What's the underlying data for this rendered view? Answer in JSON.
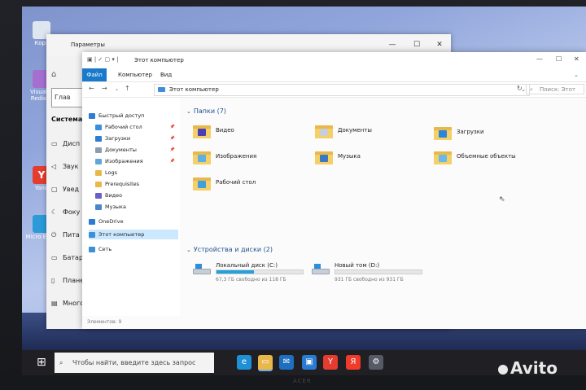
{
  "desktop": {
    "icons": [
      {
        "label": "Корз"
      },
      {
        "label": "Visual C Redistri"
      },
      {
        "label": "Yand"
      },
      {
        "label": "Micro Edge"
      }
    ]
  },
  "settings": {
    "title": "Параметры",
    "search_value": "Глав",
    "section": "Система",
    "items": [
      {
        "label": "Дисп",
        "icon": "monitor-icon"
      },
      {
        "label": "Звук",
        "icon": "speaker-icon"
      },
      {
        "label": "Увед",
        "icon": "notification-icon"
      },
      {
        "label": "Фоку",
        "icon": "moon-icon"
      },
      {
        "label": "Пита",
        "icon": "power-icon"
      },
      {
        "label": "Батар",
        "icon": "battery-icon"
      },
      {
        "label": "Плане",
        "icon": "tablet-icon"
      },
      {
        "label": "Много",
        "icon": "multitask-icon"
      }
    ]
  },
  "explorer": {
    "title": "Этот компьютер",
    "ribbon_tabs": [
      "Файл",
      "Компьютер",
      "Вид"
    ],
    "address": "Этот компьютер",
    "search_placeholder": "Поиск: Этот компьютер",
    "nav": [
      {
        "label": "Быстрый доступ",
        "icon": "star-icon",
        "color": "#2e7dd1",
        "pinned": false,
        "indent": 0
      },
      {
        "label": "Рабочий стол",
        "icon": "desktop-folder-icon",
        "color": "#3b8fd9",
        "pinned": true,
        "indent": 1
      },
      {
        "label": "Загрузки",
        "icon": "download-icon",
        "color": "#2e7dd1",
        "pinned": true,
        "indent": 1
      },
      {
        "label": "Документы",
        "icon": "documents-icon",
        "color": "#8d9bb0",
        "pinned": true,
        "indent": 1
      },
      {
        "label": "Изображения",
        "icon": "pictures-icon",
        "color": "#5ea8d8",
        "pinned": true,
        "indent": 1
      },
      {
        "label": "Logs",
        "icon": "folder-icon",
        "color": "#e8b84a",
        "pinned": false,
        "indent": 1
      },
      {
        "label": "Prerequisites",
        "icon": "folder-icon",
        "color": "#e8b84a",
        "pinned": false,
        "indent": 1
      },
      {
        "label": "Видео",
        "icon": "video-folder-icon",
        "color": "#6a5fc7",
        "pinned": false,
        "indent": 1
      },
      {
        "label": "Музыка",
        "icon": "music-folder-icon",
        "color": "#4a86c8",
        "pinned": false,
        "indent": 1
      },
      {
        "label": "OneDrive",
        "icon": "cloud-icon",
        "color": "#2a7bd3",
        "pinned": false,
        "indent": 0
      },
      {
        "label": "Этот компьютер",
        "icon": "computer-icon",
        "color": "#3c8fd8",
        "pinned": false,
        "indent": 0
      },
      {
        "label": "Сеть",
        "icon": "network-icon",
        "color": "#3c8fd8",
        "pinned": false,
        "indent": 0
      }
    ],
    "folders_header": "Папки (7)",
    "folders": [
      {
        "label": "Видео",
        "icon": "video-folder-icon",
        "glyph": "#4b3fb5"
      },
      {
        "label": "Документы",
        "icon": "documents-folder-icon",
        "glyph": "#c8ced8"
      },
      {
        "label": "Загрузки",
        "icon": "downloads-folder-icon",
        "glyph": "#2a86d8"
      },
      {
        "label": "Изображения",
        "icon": "pictures-folder-icon",
        "glyph": "#5eb0e0"
      },
      {
        "label": "Музыка",
        "icon": "music-folder-icon",
        "glyph": "#3a78c4"
      },
      {
        "label": "Объемные объекты",
        "icon": "3d-objects-folder-icon",
        "glyph": "#6ab8e6"
      },
      {
        "label": "Рабочий стол",
        "icon": "desktop-folder-icon",
        "glyph": "#3fa0e0"
      }
    ],
    "drives_header": "Устройства и диски (2)",
    "drives": [
      {
        "label": "Локальный диск (C:)",
        "free_text": "67,3 ГБ свободно из 118 ГБ",
        "used_fraction": 0.43
      },
      {
        "label": "Новый том (D:)",
        "free_text": "931 ГБ свободно из 931 ГБ",
        "used_fraction": 0.0
      }
    ],
    "status": "Элементов: 9"
  },
  "taskbar": {
    "search_placeholder": "Чтобы найти, введите здесь запрос",
    "apps": [
      {
        "name": "edge-icon",
        "color": "#1f8fd6",
        "glyph": "e"
      },
      {
        "name": "file-explorer-icon",
        "color": "#e8b84a",
        "glyph": "▭"
      },
      {
        "name": "mail-icon",
        "color": "#1e6fc0",
        "glyph": "✉"
      },
      {
        "name": "store-icon",
        "color": "#2a7bd3",
        "glyph": "▣"
      },
      {
        "name": "yandex-browser-icon",
        "color": "#e43d30",
        "glyph": "Y"
      },
      {
        "name": "yandex-icon",
        "color": "#f03a2a",
        "glyph": "Я"
      },
      {
        "name": "settings-gear-icon",
        "color": "#555a66",
        "glyph": "⚙"
      }
    ]
  },
  "watermark": "Avito",
  "laptop_brand": "ACER"
}
